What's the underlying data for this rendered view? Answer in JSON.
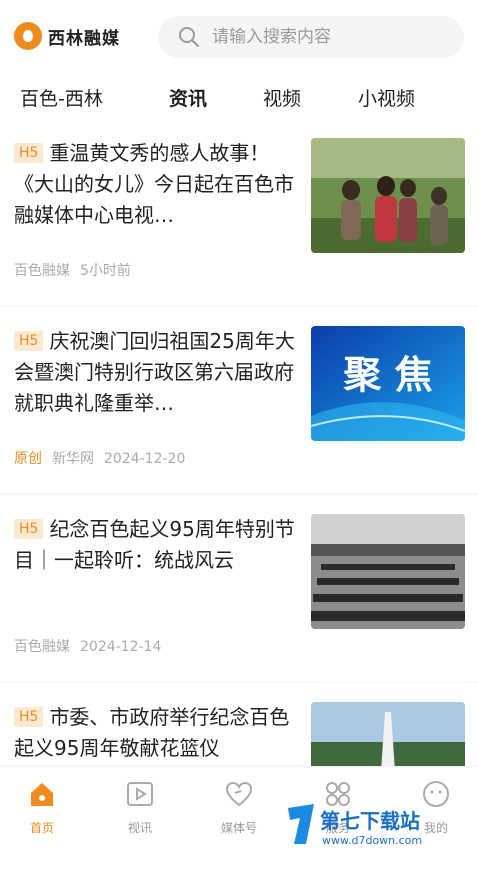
{
  "header": {
    "logo_text": "西林融媒",
    "search_placeholder": "请输入搜索内容"
  },
  "tabs": [
    {
      "label": "百色-西林"
    },
    {
      "label": "资讯"
    },
    {
      "label": "视频"
    },
    {
      "label": "小视频"
    }
  ],
  "articles": [
    {
      "badge": "H5",
      "title": "重温黄文秀的感人故事！《大山的女儿》今日起在百色市融媒体中心电视…",
      "source": "百色融媒",
      "time": "5小时前"
    },
    {
      "badge": "H5",
      "title": "庆祝澳门回归祖国25周年大会暨澳门特别行政区第六届政府就职典礼隆重举…",
      "tag": "原创",
      "source": "新华网",
      "time": "2024-12-20",
      "thumb_text": "聚 焦"
    },
    {
      "badge": "H5",
      "title": "纪念百色起义95周年特别节目｜一起聆听：统战风云",
      "source": "百色融媒",
      "time": "2024-12-14"
    },
    {
      "badge": "H5",
      "title": "市委、市政府举行纪念百色起义95周年敬献花篮仪"
    }
  ],
  "bottom_nav": [
    {
      "label": "首页",
      "icon": "home-icon"
    },
    {
      "label": "视讯",
      "icon": "video-play-icon"
    },
    {
      "label": "媒体号",
      "icon": "heart-link-icon"
    },
    {
      "label": "服务",
      "icon": "services-grid-icon"
    },
    {
      "label": "我的",
      "icon": "smiley-icon"
    }
  ],
  "watermark": {
    "text": "第七下载站",
    "url": "www.d7down.com"
  },
  "colors": {
    "accent": "#f08c1e",
    "badge_bg": "#fde8d2",
    "meta": "#aaaaaa"
  }
}
